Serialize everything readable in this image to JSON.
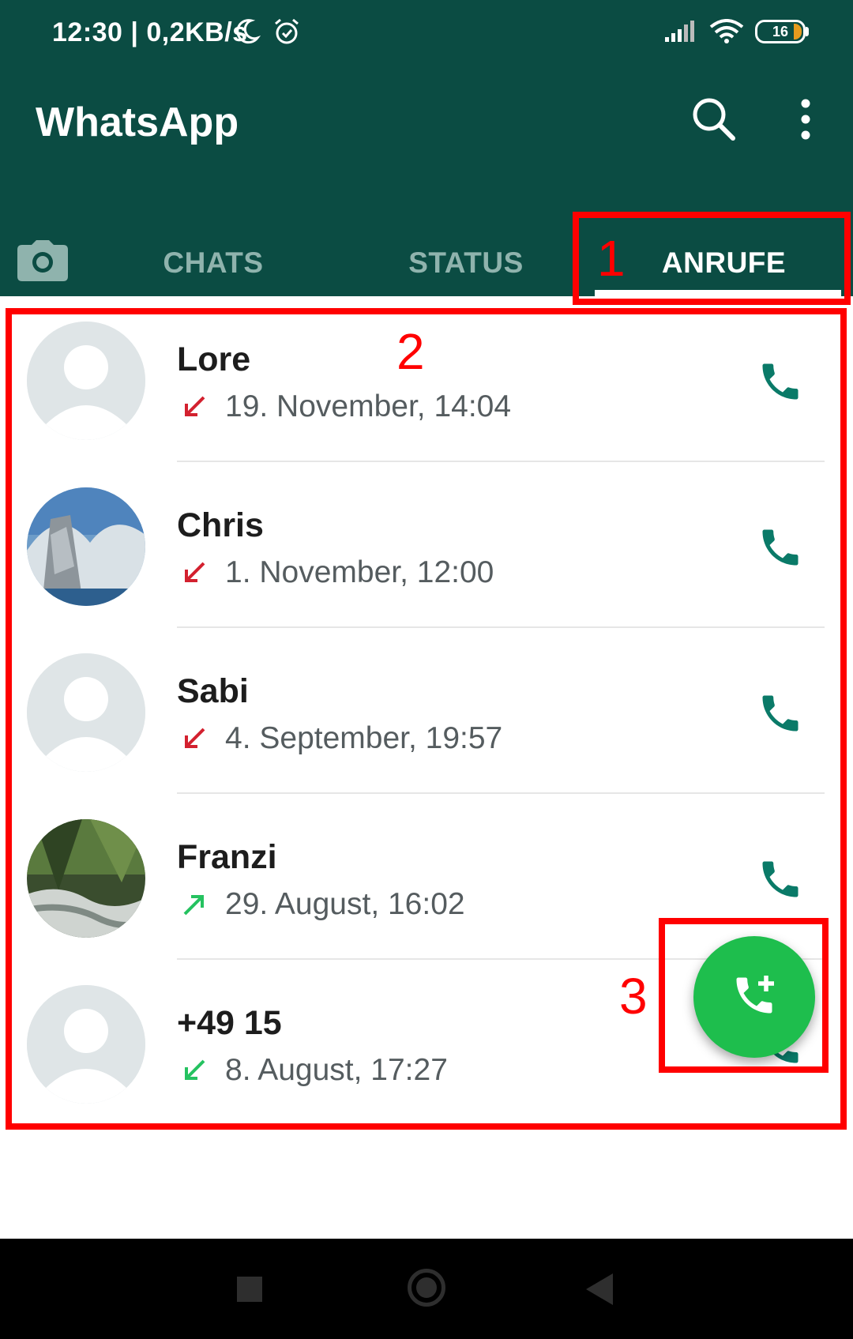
{
  "status_bar": {
    "time_speed": "12:30 | 0,2KB/s",
    "battery": "16"
  },
  "app_bar": {
    "title": "WhatsApp"
  },
  "tabs": [
    {
      "label": "CHATS",
      "selected": false
    },
    {
      "label": "STATUS",
      "selected": false
    },
    {
      "label": "ANRUFE",
      "selected": true
    }
  ],
  "calls": [
    {
      "name": "Lore",
      "time": "19. November, 14:04",
      "direction": "incoming-missed",
      "arrow_color": "#d3212f"
    },
    {
      "name": "Chris",
      "time": "1. November, 12:00",
      "direction": "incoming-missed",
      "arrow_color": "#d3212f"
    },
    {
      "name": "Sabi",
      "time": "4. September, 19:57",
      "direction": "incoming-missed",
      "arrow_color": "#d3212f"
    },
    {
      "name": "Franzi",
      "time": "29. August, 16:02",
      "direction": "outgoing",
      "arrow_color": "#25c260"
    },
    {
      "name": "+49 15",
      "time": "8. August, 17:27",
      "direction": "incoming",
      "arrow_color": "#25c260"
    }
  ],
  "annotations": [
    "1",
    "2",
    "3"
  ],
  "colors": {
    "header": "#0b4c43",
    "call_icon": "#0a7a68",
    "fab": "#1ebe4d",
    "annotation": "#ff0000"
  },
  "icons": {
    "search": "search-icon",
    "menu": "more-vert-icon",
    "camera": "camera-icon",
    "call": "phone-icon",
    "new_call": "add-call-icon"
  }
}
